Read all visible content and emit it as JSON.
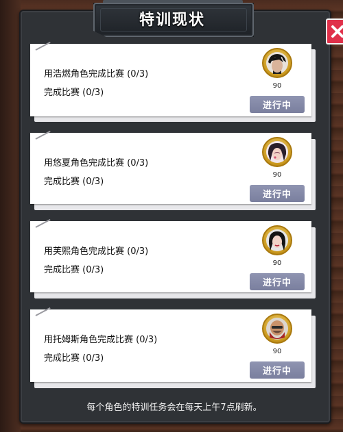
{
  "dialog": {
    "title": "特训现状",
    "footer": "每个角色的特训任务会在每天上午7点刷新。"
  },
  "tasks": [
    {
      "line1": "用浩燃角色完成比赛 (0/3)",
      "line2": "完成比赛 (0/3)",
      "reward": "90",
      "status": "进行中",
      "avatar": "character-haoran-avatar"
    },
    {
      "line1": "用悠夏角色完成比赛 (0/3)",
      "line2": "完成比赛 (0/3)",
      "reward": "90",
      "status": "进行中",
      "avatar": "character-youxia-avatar"
    },
    {
      "line1": "用芙熙角色完成比赛 (0/3)",
      "line2": "完成比赛 (0/3)",
      "reward": "90",
      "status": "进行中",
      "avatar": "character-fuxi-avatar"
    },
    {
      "line1": "用托姆斯角色完成比赛 (0/3)",
      "line2": "完成比赛 (0/3)",
      "reward": "90",
      "status": "进行中",
      "avatar": "character-toms-avatar"
    }
  ],
  "colors": {
    "close_button": "#e0304a",
    "status_button": "#7f84a3",
    "panel": "#2f3236"
  }
}
